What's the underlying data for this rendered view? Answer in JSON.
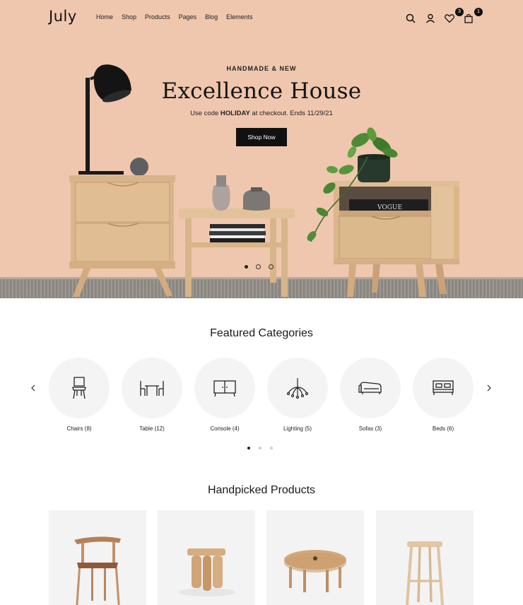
{
  "header": {
    "logo": "July",
    "nav": [
      "Home",
      "Shop",
      "Products",
      "Pages",
      "Blog",
      "Elements"
    ],
    "icons": [
      "search-icon",
      "user-icon",
      "heart-icon",
      "bag-icon"
    ],
    "wishlist_count": "3",
    "cart_count": "1"
  },
  "hero": {
    "eyebrow": "HANDMADE & NEW",
    "title": "Excellence House",
    "subtitle_pre": "Use code ",
    "subtitle_code": "HOLIDAY",
    "subtitle_post": " at checkout. Ends 11/29/21",
    "cta": "Shop Now",
    "book_spine": "VOGUE",
    "slides": 3,
    "active_slide": 1
  },
  "categories": {
    "title": "Featured Categories",
    "items": [
      {
        "label": "Chairs (8)",
        "icon": "chair-icon"
      },
      {
        "label": "Table (12)",
        "icon": "table-icon"
      },
      {
        "label": "Console (4)",
        "icon": "console-icon"
      },
      {
        "label": "Lighting (5)",
        "icon": "chandelier-icon"
      },
      {
        "label": "Sofas (3)",
        "icon": "sofa-icon"
      },
      {
        "label": "Beds (6)",
        "icon": "bed-icon"
      }
    ],
    "pages": 3,
    "active_page": 1
  },
  "products": {
    "title": "Handpicked Products",
    "items": [
      "wooden-armchair",
      "wooden-stool",
      "round-coffee-table",
      "bar-stool"
    ]
  },
  "colors": {
    "hero_bg": "#efc7ae",
    "accent": "#111111",
    "wood": "#dcb88f"
  }
}
